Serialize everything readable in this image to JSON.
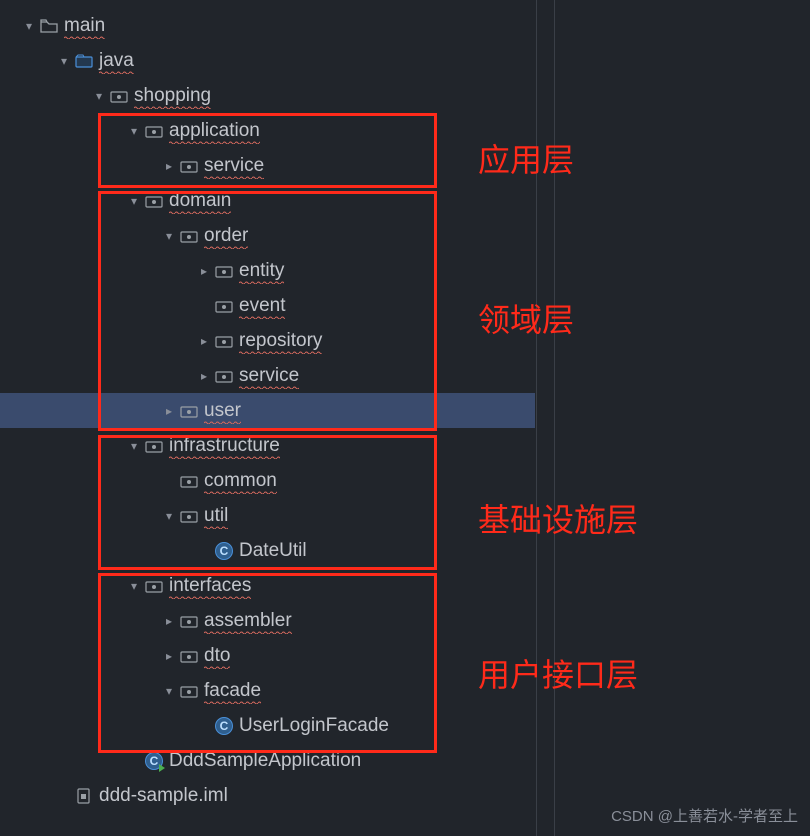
{
  "tree": {
    "main": "main",
    "java": "java",
    "shopping": "shopping",
    "application": "application",
    "application_service": "service",
    "domain": "domain",
    "order": "order",
    "entity": "entity",
    "event": "event",
    "repository": "repository",
    "order_service": "service",
    "user": "user",
    "infrastructure": "infrastructure",
    "common": "common",
    "util": "util",
    "dateutil": "DateUtil",
    "interfaces": "interfaces",
    "assembler": "assembler",
    "dto": "dto",
    "facade": "facade",
    "userloginfacade": "UserLoginFacade",
    "dddsampleapp": "DddSampleApplication",
    "iml": "ddd-sample.iml"
  },
  "annotations": {
    "app_layer": "应用层",
    "domain_layer": "领域层",
    "infra_layer": "基础设施层",
    "ui_layer": "用户接口层"
  },
  "watermark": "CSDN @上善若水-学者至上"
}
